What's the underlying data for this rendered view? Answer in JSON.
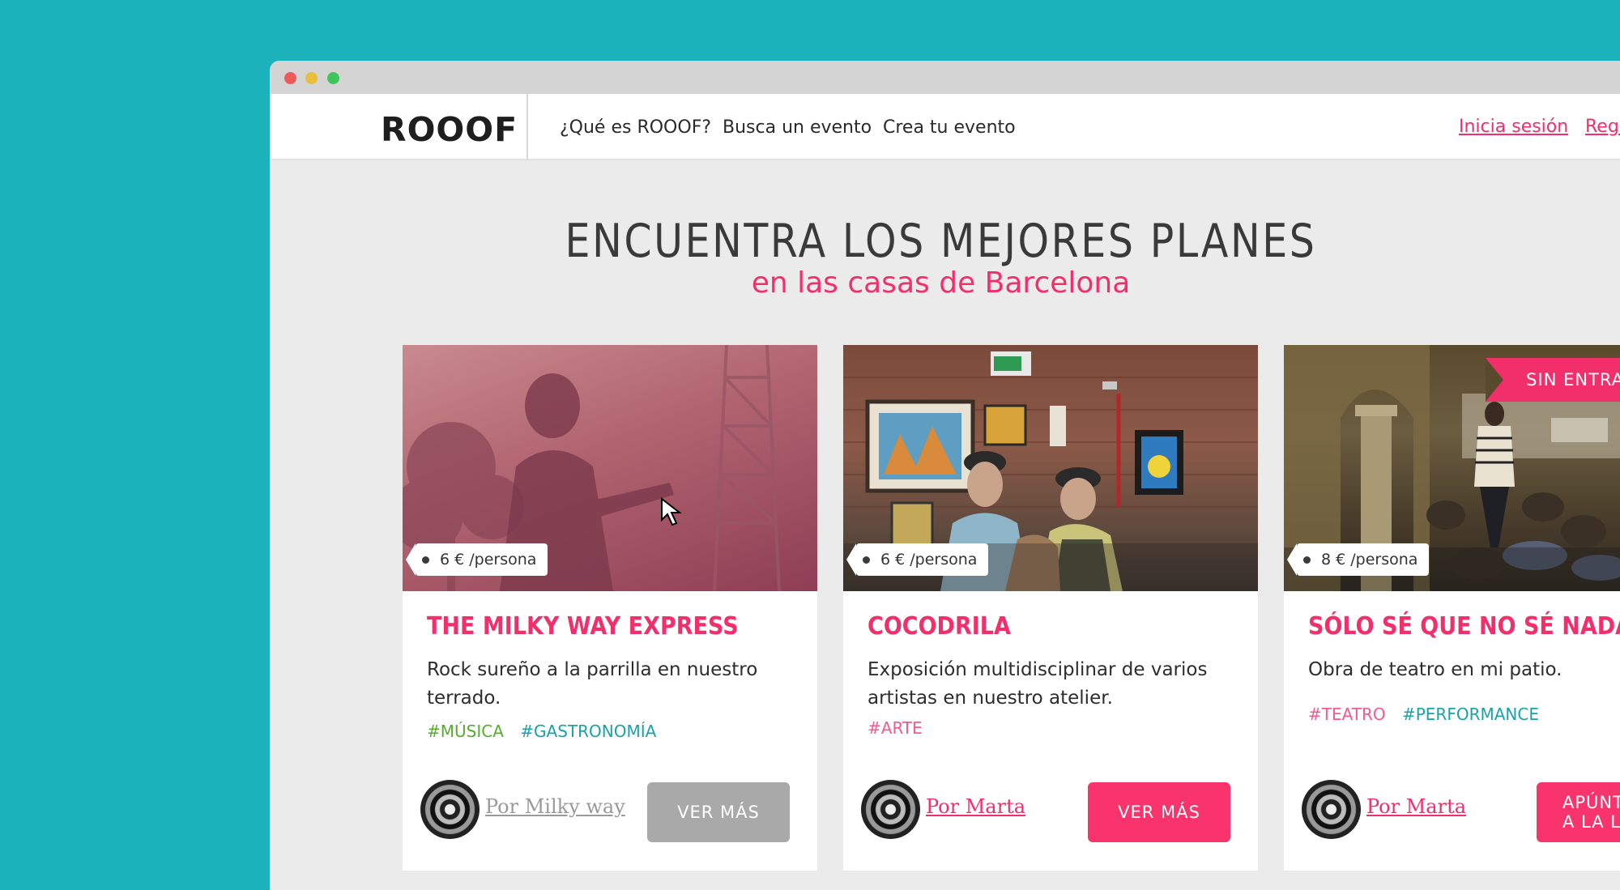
{
  "window": {
    "traffic_lights": [
      "close",
      "minimize",
      "zoom"
    ]
  },
  "nav": {
    "logo": "ROOOF",
    "links": [
      "¿Qué es ROOOF?",
      "Busca un evento",
      "Crea tu evento"
    ],
    "login": "Inicia sesión",
    "register": "Regí"
  },
  "hero": {
    "title": "ENCUENTRA LOS MEJORES PLANES",
    "subtitle": "en las casas de Barcelona"
  },
  "cards": [
    {
      "price": "6 € /persona",
      "title": "THE MILKY WAY EXPRESS",
      "description": "Rock sureño a la parrilla en nuestro terrado.",
      "tags": [
        "#MÚSICA",
        "#GASTRONOMÍA"
      ],
      "author": "Por Milky way",
      "button": "VER MÁS"
    },
    {
      "price": "6 € /persona",
      "title": "COCODRILA",
      "description": "Exposición multidisciplinar de varios artistas en nuestro atelier.",
      "tags": [
        "#ARTE"
      ],
      "author": "Por Marta",
      "button": "VER MÁS"
    },
    {
      "ribbon": "SIN ENTRA",
      "price": "8 € /persona",
      "title": "SÓLO SÉ QUE NO SÉ NADA",
      "description": "Obra de teatro en mi patio.",
      "tags": [
        "#TEATRO",
        "#PERFORMANCE"
      ],
      "author": "Por Marta",
      "button_line1": "APÚNT",
      "button_line2": "A LA LI"
    }
  ],
  "colors": {
    "background": "#1bb2bc",
    "accent": "#f22e6b",
    "button_disabled": "#a9a9a9"
  }
}
